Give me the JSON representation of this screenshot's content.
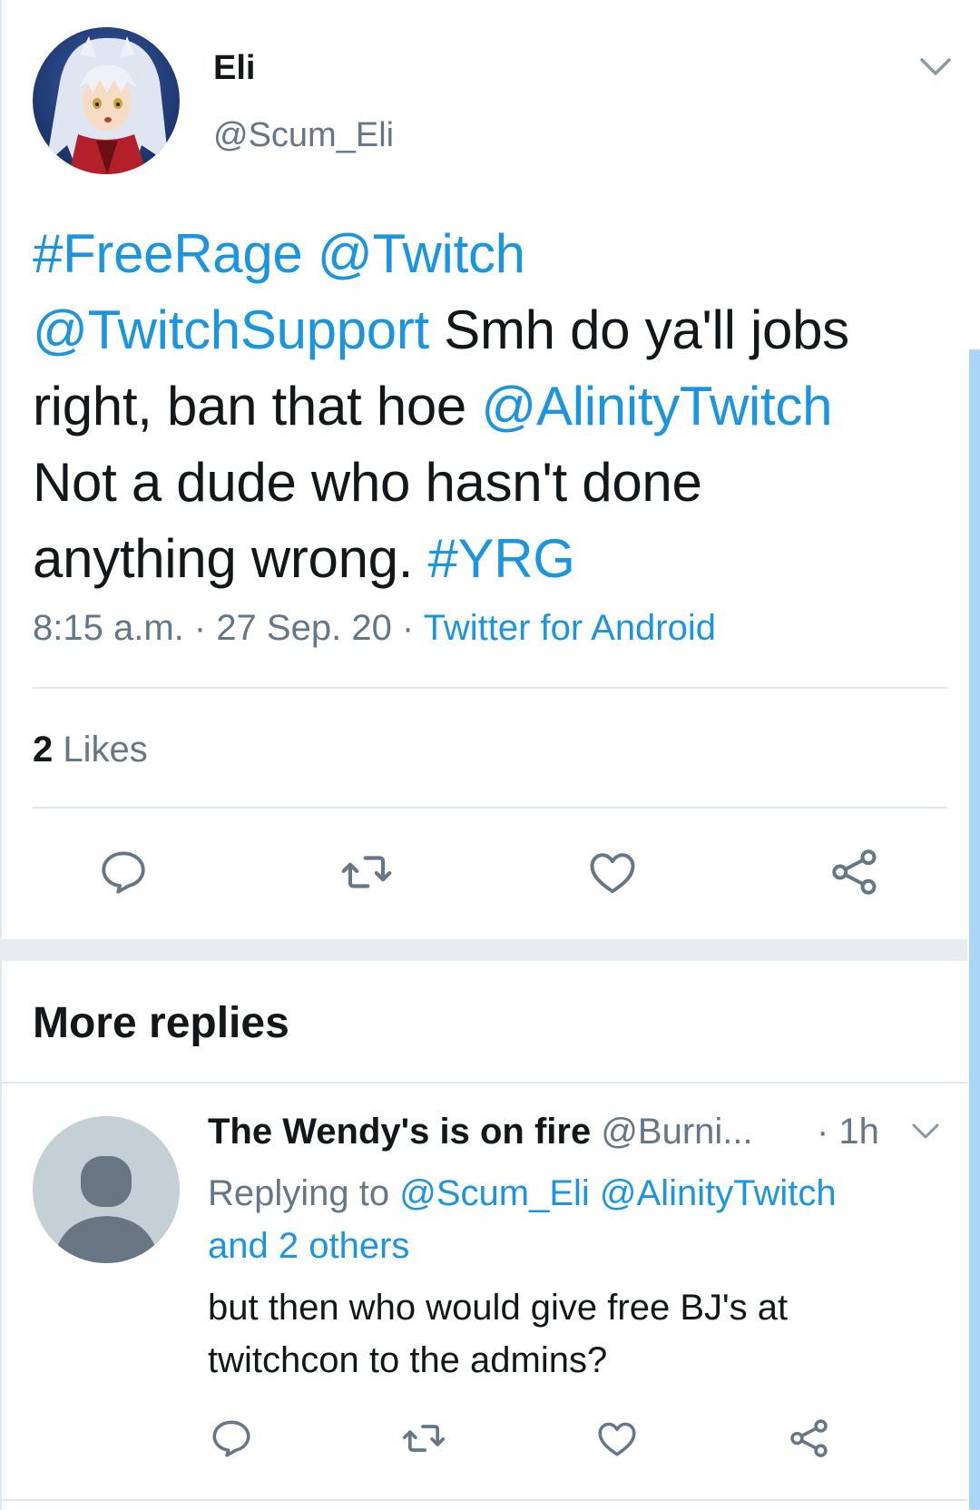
{
  "tweet": {
    "author_name": "Eli",
    "author_handle": "@Scum_Eli",
    "avatar": "anime-character-avatar",
    "body_lines": [
      [
        {
          "t": "#FreeRage",
          "link": true
        },
        {
          "t": " ",
          "link": false
        },
        {
          "t": "@Twitch",
          "link": true
        }
      ],
      [
        {
          "t": "@TwitchSupport",
          "link": true
        },
        {
          "t": " Smh do ya'll jobs",
          "link": false
        }
      ],
      [
        {
          "t": "right, ban that hoe ",
          "link": false
        },
        {
          "t": "@AlinityTwitch",
          "link": true
        }
      ],
      [
        {
          "t": "Not a dude who hasn't done",
          "link": false
        }
      ],
      [
        {
          "t": "anything wrong. ",
          "link": false
        },
        {
          "t": "#YRG",
          "link": true
        }
      ]
    ],
    "time": "8:15 a.m.",
    "date": "27 Sep. 20",
    "separator": " · ",
    "source": "Twitter for Android",
    "likes_count": "2",
    "likes_label": " Likes",
    "actions": [
      "reply-icon",
      "retweet-icon",
      "like-icon",
      "share-icon"
    ]
  },
  "section_title": "More replies",
  "reply": {
    "author_name": "The Wendy's is on fire",
    "author_handle": "@Burni...",
    "time": "· 1h",
    "avatar": "default-profile-avatar",
    "replying_prefix": "Replying to ",
    "replying_to_1": "@Scum_Eli",
    "replying_to_2": "@AlinityTwitch",
    "replying_others": "and 2 others",
    "text_line_1": "but then who would give free BJ's at",
    "text_line_2": "twitchcon to the admins?",
    "actions": [
      "reply-icon",
      "retweet-icon",
      "like-icon",
      "share-icon"
    ]
  },
  "colors": {
    "link": "#1b95e0",
    "muted": "#657786",
    "text": "#14171a",
    "divider": "#e1e8ed",
    "scrollbar": "#a9d6f8"
  }
}
